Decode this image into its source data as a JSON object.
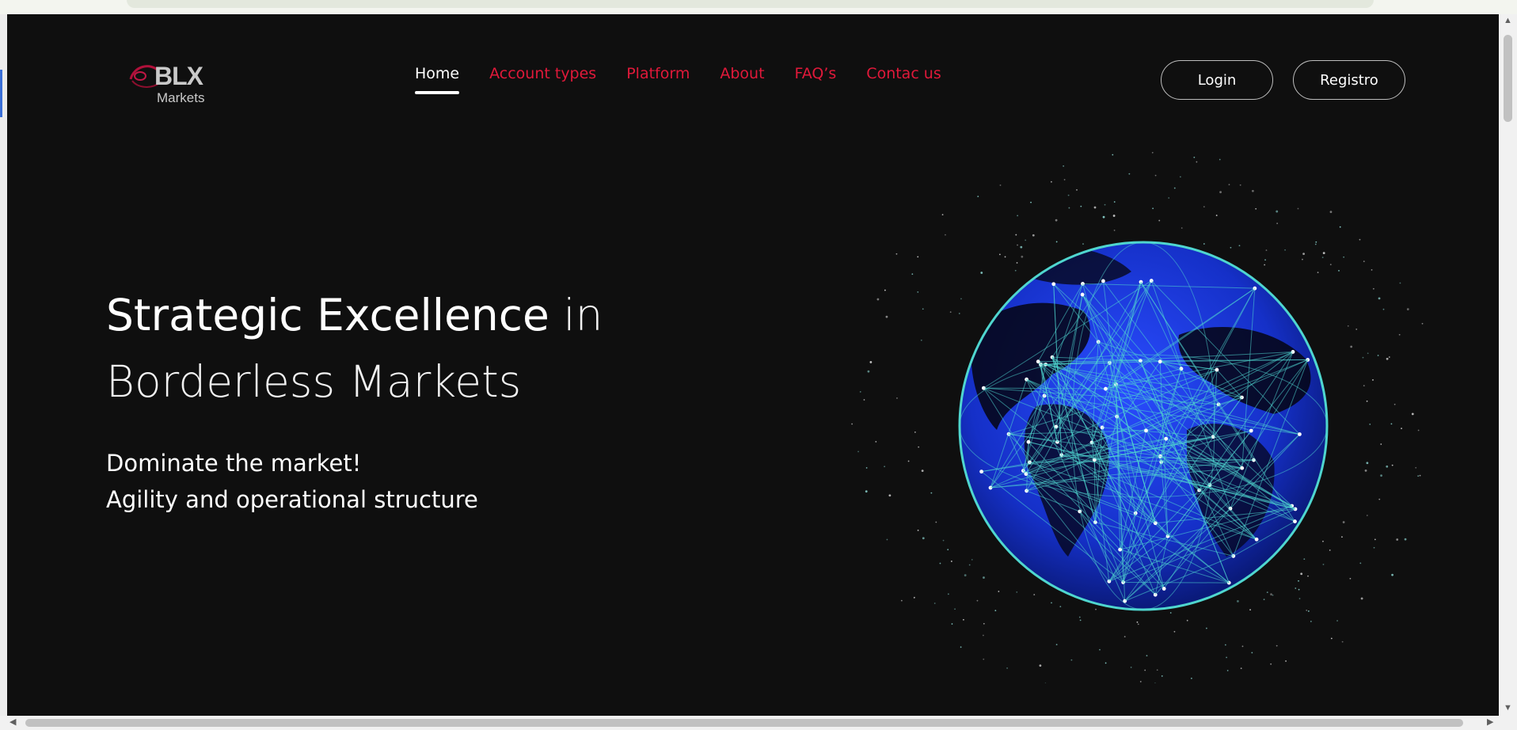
{
  "brand": {
    "logo_main": "BLX",
    "logo_sub": "Markets"
  },
  "nav": {
    "items": [
      {
        "label": "Home",
        "active": true
      },
      {
        "label": "Account types",
        "active": false
      },
      {
        "label": "Platform",
        "active": false
      },
      {
        "label": "About",
        "active": false
      },
      {
        "label": "FAQ’s",
        "active": false
      },
      {
        "label": "Contac us",
        "active": false
      }
    ],
    "login_label": "Login",
    "register_label": "Registro"
  },
  "hero": {
    "title_bold": "Strategic Excellence",
    "title_light_1": " in",
    "title_light_2": "Borderless Markets",
    "subtitle_line1": "Dominate the market!",
    "subtitle_line2": "Agility and operational structure"
  },
  "colors": {
    "background": "#0f0f0f",
    "accent": "#e0193a",
    "text": "#ffffff",
    "globe_ocean": "#1530c8",
    "globe_network": "#4fd6cf"
  },
  "icons": [
    "logo-swoosh-icon",
    "globe-network-image",
    "scroll-up-arrow",
    "scroll-down-arrow",
    "scroll-left-arrow",
    "scroll-right-arrow"
  ]
}
